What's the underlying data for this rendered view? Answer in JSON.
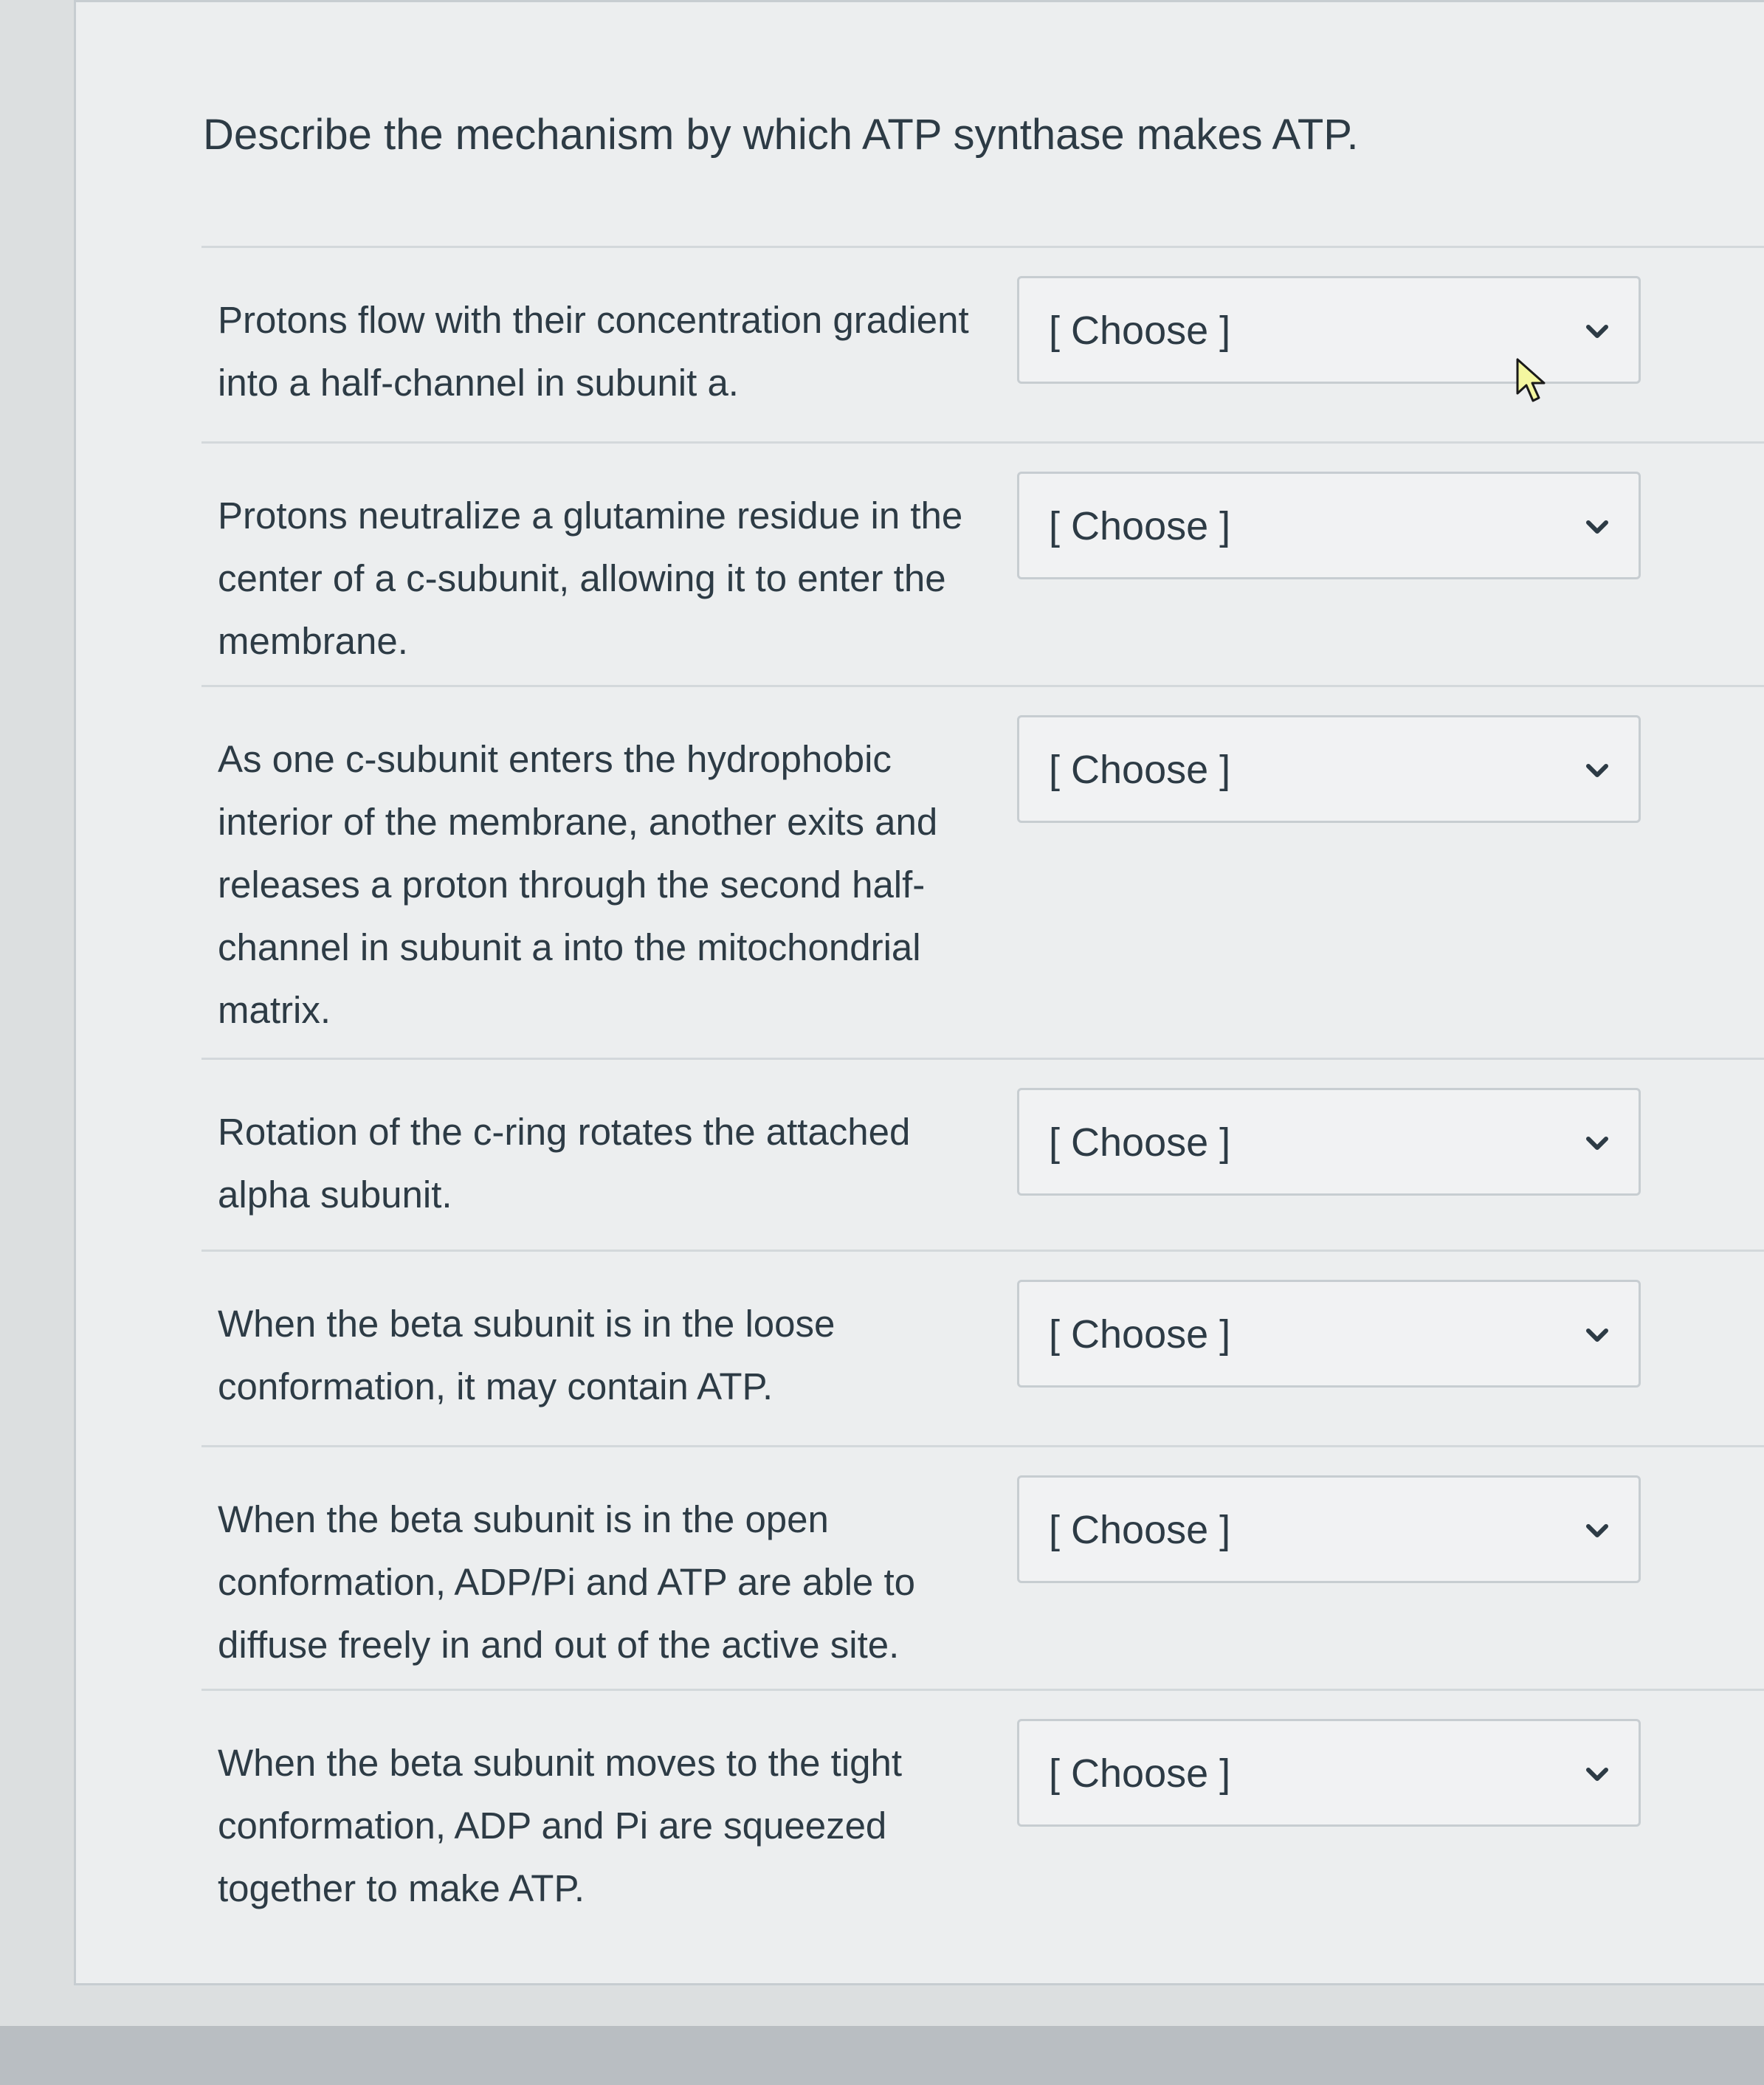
{
  "question": {
    "text": "Describe the mechanism by which ATP synthase makes ATP."
  },
  "rows": [
    {
      "statement": "Protons flow with their concentration gradient into a half-channel in subunit a.",
      "select_value": "[ Choose ]"
    },
    {
      "statement": "Protons neutralize a glutamine residue in the center of a c-subunit, allowing it to enter the membrane.",
      "select_value": "[ Choose ]"
    },
    {
      "statement": "As one c-subunit enters the hydrophobic interior of the membrane, another exits and releases a proton through the second half-channel in subunit a into the mitochondrial matrix.",
      "select_value": "[ Choose ]"
    },
    {
      "statement": "Rotation of the c-ring rotates the attached alpha subunit.",
      "select_value": "[ Choose ]"
    },
    {
      "statement": "When the beta subunit is in the loose conformation, it may contain ATP.",
      "select_value": "[ Choose ]"
    },
    {
      "statement": "When the beta subunit is in the open conformation, ADP/Pi and ATP are able to diffuse freely in and out of the active site.",
      "select_value": "[ Choose ]"
    },
    {
      "statement": "When the beta subunit moves to the tight conformation, ADP and Pi are squeezed together to make ATP.",
      "select_value": "[ Choose ]"
    }
  ],
  "icons": {
    "dropdown": "chevron-down-icon",
    "pointer": "cursor-arrow-icon"
  },
  "colors": {
    "text": "#2d3b45",
    "card_background": "#eceeef",
    "select_border": "#c7cdd1",
    "divider": "#d3d8db"
  }
}
